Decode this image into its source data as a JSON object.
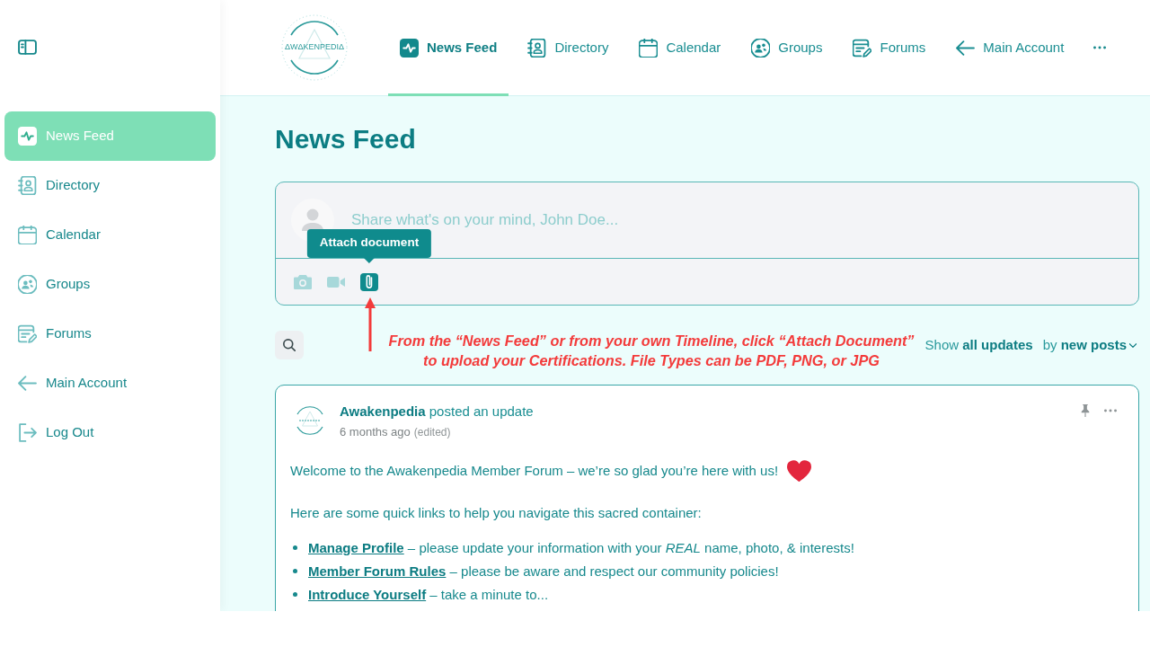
{
  "sidebar": {
    "items": [
      {
        "kind": "feed",
        "label": "News Feed",
        "selected": true
      },
      {
        "kind": "directory",
        "label": "Directory",
        "selected": false
      },
      {
        "kind": "calendar",
        "label": "Calendar",
        "selected": false
      },
      {
        "kind": "groups",
        "label": "Groups",
        "selected": false
      },
      {
        "kind": "forums",
        "label": "Forums",
        "selected": false
      },
      {
        "kind": "back",
        "label": "Main Account",
        "selected": false
      },
      {
        "kind": "logout",
        "label": "Log Out",
        "selected": false
      }
    ]
  },
  "header": {
    "logo": {
      "text": "ΔWΔKENPEDIΔ"
    },
    "tabs": [
      {
        "kind": "feed",
        "label": "News Feed",
        "selected": true
      },
      {
        "kind": "directory",
        "label": "Directory",
        "selected": false
      },
      {
        "kind": "calendar",
        "label": "Calendar",
        "selected": false
      },
      {
        "kind": "groups",
        "label": "Groups",
        "selected": false
      },
      {
        "kind": "forums",
        "label": "Forums",
        "selected": false
      },
      {
        "kind": "back",
        "label": "Main Account",
        "selected": false
      }
    ]
  },
  "page_title": "News Feed",
  "composer": {
    "placeholder": "Share what's on your mind, John Doe...",
    "tools": [
      {
        "kind": "photo",
        "active": false
      },
      {
        "kind": "video",
        "active": false
      },
      {
        "kind": "document",
        "active": true,
        "tooltip": "Attach document"
      }
    ]
  },
  "annotation": {
    "text": "From the “News Feed” or from your own Timeline, click “Attach Document”\nto upload your Certifications. File Types can be PDF, PNG, or JPG"
  },
  "filters": [
    {
      "text": "Show **all updates**",
      "caret": false
    },
    {
      "text": "by **new posts**",
      "caret": true
    }
  ],
  "post": {
    "author_line": "**Awakenpedia** posted an update",
    "time": "6 months ago",
    "edited": "(edited)",
    "paragraphs": [
      {
        "kind": "with_heart",
        "text": "Welcome to the Awakenpedia Member Forum – we’re so glad you’re here with us!"
      },
      {
        "kind": "plain",
        "text": "Here are some quick links to help you navigate this sacred container:"
      }
    ],
    "links": [
      {
        "link": "Manage Profile",
        "text": "– please update your information with your *REAL* name, photo, & interests!"
      },
      {
        "link": "Member Forum Rules",
        "text": "– please be aware and respect our community policies!"
      },
      {
        "link": "Introduce Yourself",
        "text": "– take a minute to..."
      }
    ]
  }
}
